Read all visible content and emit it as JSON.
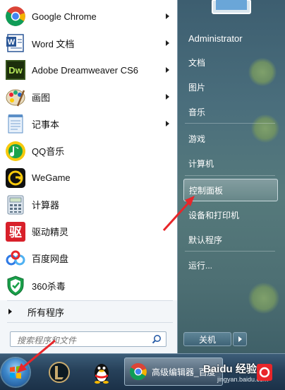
{
  "programs": [
    {
      "label": "Google Chrome",
      "icon": "chrome-icon",
      "has_submenu": true
    },
    {
      "label": "Word 文档",
      "icon": "word-icon",
      "has_submenu": true
    },
    {
      "label": "Adobe Dreamweaver CS6",
      "icon": "dreamweaver-icon",
      "has_submenu": true
    },
    {
      "label": "画图",
      "icon": "paint-icon",
      "has_submenu": true
    },
    {
      "label": "记事本",
      "icon": "notepad-icon",
      "has_submenu": true
    },
    {
      "label": "QQ音乐",
      "icon": "qqmusic-icon",
      "has_submenu": false
    },
    {
      "label": "WeGame",
      "icon": "wegame-icon",
      "has_submenu": false
    },
    {
      "label": "计算器",
      "icon": "calculator-icon",
      "has_submenu": false
    },
    {
      "label": "驱动精灵",
      "icon": "driver-genius-icon",
      "has_submenu": false
    },
    {
      "label": "百度网盘",
      "icon": "baidu-netdisk-icon",
      "has_submenu": false
    },
    {
      "label": "360杀毒",
      "icon": "360-antivirus-icon",
      "has_submenu": false
    }
  ],
  "all_programs_label": "所有程序",
  "search": {
    "placeholder": "搜索程序和文件"
  },
  "right_menu": {
    "user": "Administrator",
    "items": [
      "文档",
      "图片",
      "音乐",
      "游戏",
      "计算机",
      "控制面板",
      "设备和打印机",
      "默认程序",
      "运行..."
    ],
    "highlighted": "控制面板"
  },
  "shutdown_label": "关机",
  "taskbar": {
    "window_title": "高级编辑器_百度",
    "watermark": "Baidu 经验",
    "watermark_sub": "jingyan.baidu.com"
  },
  "colors": {
    "accent_red": "#e8262a",
    "highlight": "#ffffff"
  }
}
